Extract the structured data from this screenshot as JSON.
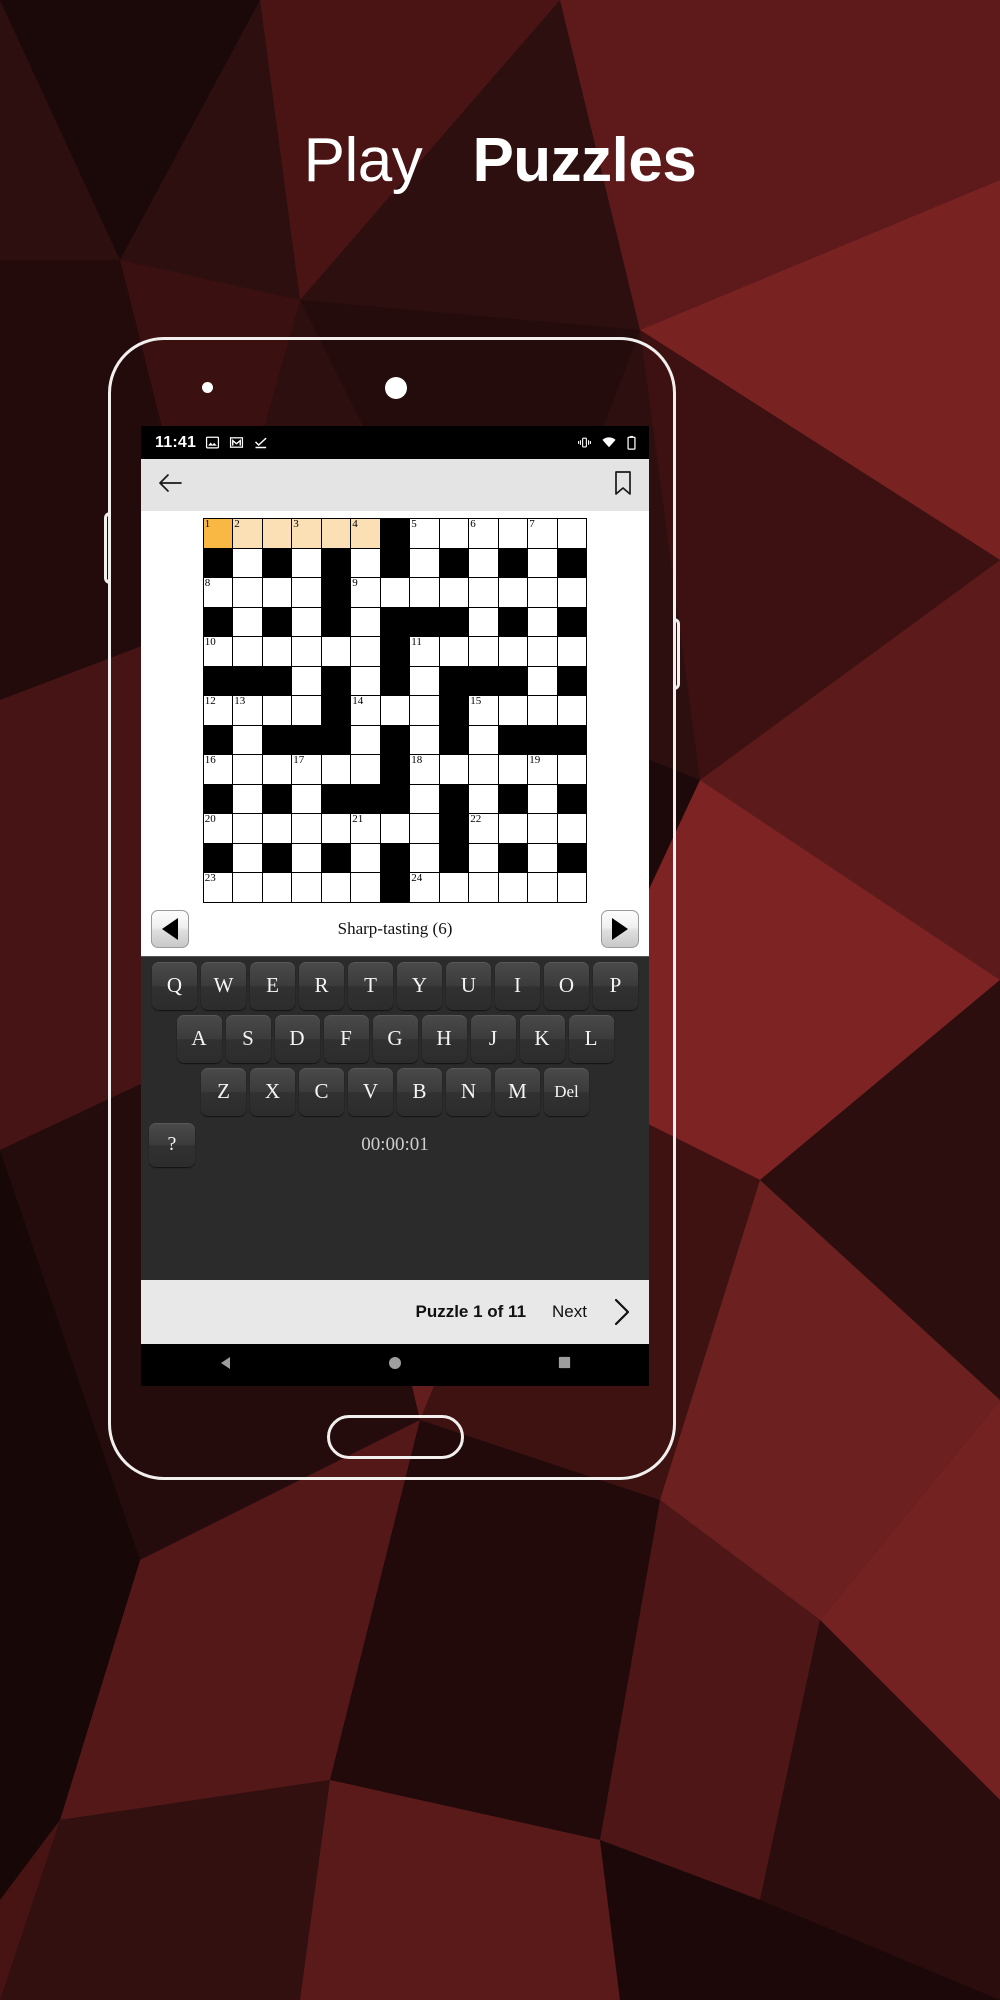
{
  "headline": {
    "light_word": "Play",
    "bold_word": "Puzzles"
  },
  "colors": {
    "background_dark": "#2a0d0d",
    "background_red": "#7a2020",
    "frame_outline": "#f2f0ee",
    "cursor_cell": "#f9b743",
    "highlight_cell": "#fae0b4",
    "appbar": "#e4e4e4",
    "keyboard_bg": "#2b2b2b",
    "key_face": "#3b3b3b",
    "puzzlebar": "#e8e8e8"
  },
  "statusbar": {
    "time": "11:41",
    "left_icons": [
      "image-icon",
      "gmail-icon",
      "checkmark-icon"
    ],
    "right_icons": [
      "vibrate-icon",
      "wifi-icon",
      "battery-icon"
    ]
  },
  "appbar": {
    "back_icon": "back-arrow-icon",
    "bookmark_icon": "bookmark-icon"
  },
  "cluebar": {
    "prev_icon": "prev-clue-arrow-icon",
    "next_icon": "next-clue-arrow-icon",
    "clue": "Sharp-tasting (6)"
  },
  "keyboard": {
    "row1": [
      "Q",
      "W",
      "E",
      "R",
      "T",
      "Y",
      "U",
      "I",
      "O",
      "P"
    ],
    "row2": [
      "A",
      "S",
      "D",
      "F",
      "G",
      "H",
      "J",
      "K",
      "L"
    ],
    "row3": [
      "Z",
      "X",
      "C",
      "V",
      "B",
      "N",
      "M",
      "Del"
    ],
    "help_key": "?",
    "timer": "00:00:01"
  },
  "puzzlebar": {
    "count": "Puzzle 1 of 11",
    "next_label": "Next",
    "next_icon": "chevron-right-icon"
  },
  "androidnav": {
    "back": "nav-back-icon",
    "home": "nav-home-icon",
    "recents": "nav-recents-icon"
  },
  "crossword": {
    "cols": 13,
    "rows": 13,
    "cursor": {
      "row": 0,
      "col": 0
    },
    "highlight_row": 0,
    "highlight_cols": [
      0,
      1,
      2,
      3,
      4,
      5
    ],
    "grid": [
      "WWWWWWBWWWWWW",
      "BWBWBWBWBWBWB",
      "WWWWBWWWWWWWW",
      "BWBWBWBBBWBWB",
      "WWWWWWBWWWWWW",
      "BBBWBWBWBBBWB",
      "WWWWBWWWBWWWW",
      "BWBBBWBWBWBBB",
      "WWWWWWBWWWWWW",
      "BWBWBBBWBWBWB",
      "WWWWWWWWBWWWW",
      "BWBWBWBWBWBWB",
      "WWWWWWBWWWWWW"
    ],
    "numbers": [
      {
        "row": 0,
        "col": 0,
        "n": 1
      },
      {
        "row": 0,
        "col": 1,
        "n": 2
      },
      {
        "row": 0,
        "col": 3,
        "n": 3
      },
      {
        "row": 0,
        "col": 5,
        "n": 4
      },
      {
        "row": 0,
        "col": 7,
        "n": 5
      },
      {
        "row": 0,
        "col": 9,
        "n": 6
      },
      {
        "row": 0,
        "col": 11,
        "n": 7
      },
      {
        "row": 2,
        "col": 0,
        "n": 8
      },
      {
        "row": 2,
        "col": 5,
        "n": 9
      },
      {
        "row": 4,
        "col": 0,
        "n": 10
      },
      {
        "row": 4,
        "col": 7,
        "n": 11
      },
      {
        "row": 6,
        "col": 0,
        "n": 12
      },
      {
        "row": 6,
        "col": 1,
        "n": 13
      },
      {
        "row": 6,
        "col": 5,
        "n": 14
      },
      {
        "row": 6,
        "col": 9,
        "n": 15
      },
      {
        "row": 8,
        "col": 0,
        "n": 16
      },
      {
        "row": 8,
        "col": 3,
        "n": 17
      },
      {
        "row": 8,
        "col": 7,
        "n": 18
      },
      {
        "row": 8,
        "col": 11,
        "n": 19
      },
      {
        "row": 10,
        "col": 0,
        "n": 20
      },
      {
        "row": 10,
        "col": 5,
        "n": 21
      },
      {
        "row": 10,
        "col": 9,
        "n": 22
      },
      {
        "row": 12,
        "col": 0,
        "n": 23
      },
      {
        "row": 12,
        "col": 7,
        "n": 24
      }
    ]
  }
}
